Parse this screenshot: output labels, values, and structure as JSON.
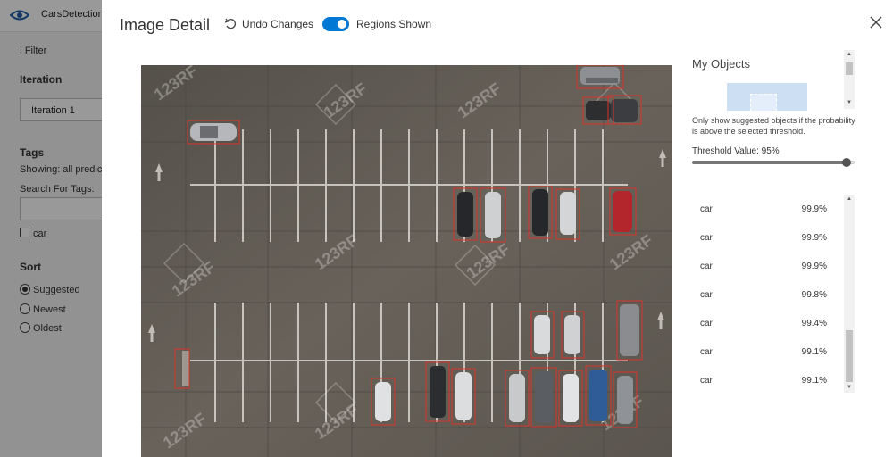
{
  "app": {
    "name": "CarsDetection"
  },
  "sidebar": {
    "filter_label": "Filter",
    "iteration_heading": "Iteration",
    "iteration_value": "Iteration 1",
    "tags_heading": "Tags",
    "showing_text": "Showing: all predicte",
    "search_label": "Search For Tags:",
    "tag_car": "car",
    "sort_heading": "Sort",
    "sort_options": [
      {
        "label": "Suggested",
        "selected": true
      },
      {
        "label": "Newest",
        "selected": false
      },
      {
        "label": "Oldest",
        "selected": false
      }
    ]
  },
  "modal": {
    "title": "Image Detail",
    "undo_label": "Undo Changes",
    "regions_label": "Regions Shown",
    "regions_on": true,
    "accent_color": "#0078d4",
    "region_color": "#d9342b"
  },
  "panel": {
    "title": "My Objects",
    "hint": "Only show suggested objects if the probability is above the selected threshold.",
    "threshold_label": "Threshold Value: 95%",
    "threshold_value": 0.95,
    "objects": [
      {
        "tag": "car",
        "prob": "99.9%"
      },
      {
        "tag": "car",
        "prob": "99.9%"
      },
      {
        "tag": "car",
        "prob": "99.9%"
      },
      {
        "tag": "car",
        "prob": "99.8%"
      },
      {
        "tag": "car",
        "prob": "99.4%"
      },
      {
        "tag": "car",
        "prob": "99.1%"
      },
      {
        "tag": "car",
        "prob": "99.1%"
      }
    ]
  },
  "image": {
    "watermark": "123RF"
  }
}
